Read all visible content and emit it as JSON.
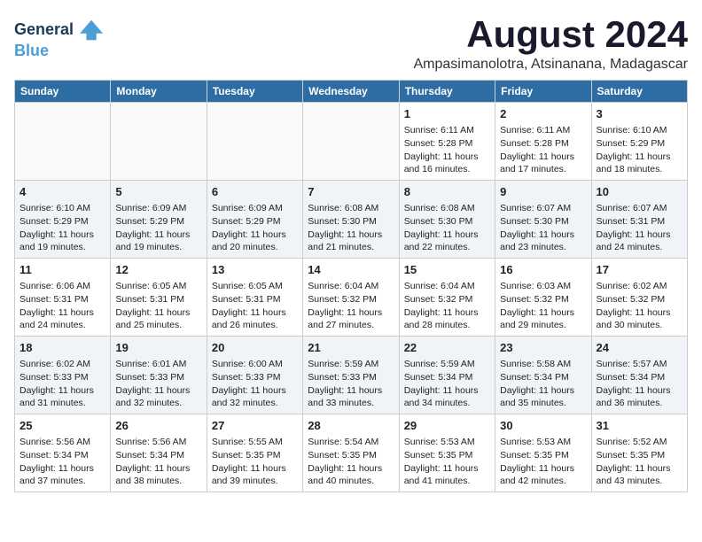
{
  "header": {
    "logo_line1": "General",
    "logo_line2": "Blue",
    "month": "August 2024",
    "location": "Ampasimanolotra, Atsinanana, Madagascar"
  },
  "weekdays": [
    "Sunday",
    "Monday",
    "Tuesday",
    "Wednesday",
    "Thursday",
    "Friday",
    "Saturday"
  ],
  "weeks": [
    [
      {
        "day": "",
        "info": ""
      },
      {
        "day": "",
        "info": ""
      },
      {
        "day": "",
        "info": ""
      },
      {
        "day": "",
        "info": ""
      },
      {
        "day": "1",
        "info": "Sunrise: 6:11 AM\nSunset: 5:28 PM\nDaylight: 11 hours and 16 minutes."
      },
      {
        "day": "2",
        "info": "Sunrise: 6:11 AM\nSunset: 5:28 PM\nDaylight: 11 hours and 17 minutes."
      },
      {
        "day": "3",
        "info": "Sunrise: 6:10 AM\nSunset: 5:29 PM\nDaylight: 11 hours and 18 minutes."
      }
    ],
    [
      {
        "day": "4",
        "info": "Sunrise: 6:10 AM\nSunset: 5:29 PM\nDaylight: 11 hours and 19 minutes."
      },
      {
        "day": "5",
        "info": "Sunrise: 6:09 AM\nSunset: 5:29 PM\nDaylight: 11 hours and 19 minutes."
      },
      {
        "day": "6",
        "info": "Sunrise: 6:09 AM\nSunset: 5:29 PM\nDaylight: 11 hours and 20 minutes."
      },
      {
        "day": "7",
        "info": "Sunrise: 6:08 AM\nSunset: 5:30 PM\nDaylight: 11 hours and 21 minutes."
      },
      {
        "day": "8",
        "info": "Sunrise: 6:08 AM\nSunset: 5:30 PM\nDaylight: 11 hours and 22 minutes."
      },
      {
        "day": "9",
        "info": "Sunrise: 6:07 AM\nSunset: 5:30 PM\nDaylight: 11 hours and 23 minutes."
      },
      {
        "day": "10",
        "info": "Sunrise: 6:07 AM\nSunset: 5:31 PM\nDaylight: 11 hours and 24 minutes."
      }
    ],
    [
      {
        "day": "11",
        "info": "Sunrise: 6:06 AM\nSunset: 5:31 PM\nDaylight: 11 hours and 24 minutes."
      },
      {
        "day": "12",
        "info": "Sunrise: 6:05 AM\nSunset: 5:31 PM\nDaylight: 11 hours and 25 minutes."
      },
      {
        "day": "13",
        "info": "Sunrise: 6:05 AM\nSunset: 5:31 PM\nDaylight: 11 hours and 26 minutes."
      },
      {
        "day": "14",
        "info": "Sunrise: 6:04 AM\nSunset: 5:32 PM\nDaylight: 11 hours and 27 minutes."
      },
      {
        "day": "15",
        "info": "Sunrise: 6:04 AM\nSunset: 5:32 PM\nDaylight: 11 hours and 28 minutes."
      },
      {
        "day": "16",
        "info": "Sunrise: 6:03 AM\nSunset: 5:32 PM\nDaylight: 11 hours and 29 minutes."
      },
      {
        "day": "17",
        "info": "Sunrise: 6:02 AM\nSunset: 5:32 PM\nDaylight: 11 hours and 30 minutes."
      }
    ],
    [
      {
        "day": "18",
        "info": "Sunrise: 6:02 AM\nSunset: 5:33 PM\nDaylight: 11 hours and 31 minutes."
      },
      {
        "day": "19",
        "info": "Sunrise: 6:01 AM\nSunset: 5:33 PM\nDaylight: 11 hours and 32 minutes."
      },
      {
        "day": "20",
        "info": "Sunrise: 6:00 AM\nSunset: 5:33 PM\nDaylight: 11 hours and 32 minutes."
      },
      {
        "day": "21",
        "info": "Sunrise: 5:59 AM\nSunset: 5:33 PM\nDaylight: 11 hours and 33 minutes."
      },
      {
        "day": "22",
        "info": "Sunrise: 5:59 AM\nSunset: 5:34 PM\nDaylight: 11 hours and 34 minutes."
      },
      {
        "day": "23",
        "info": "Sunrise: 5:58 AM\nSunset: 5:34 PM\nDaylight: 11 hours and 35 minutes."
      },
      {
        "day": "24",
        "info": "Sunrise: 5:57 AM\nSunset: 5:34 PM\nDaylight: 11 hours and 36 minutes."
      }
    ],
    [
      {
        "day": "25",
        "info": "Sunrise: 5:56 AM\nSunset: 5:34 PM\nDaylight: 11 hours and 37 minutes."
      },
      {
        "day": "26",
        "info": "Sunrise: 5:56 AM\nSunset: 5:34 PM\nDaylight: 11 hours and 38 minutes."
      },
      {
        "day": "27",
        "info": "Sunrise: 5:55 AM\nSunset: 5:35 PM\nDaylight: 11 hours and 39 minutes."
      },
      {
        "day": "28",
        "info": "Sunrise: 5:54 AM\nSunset: 5:35 PM\nDaylight: 11 hours and 40 minutes."
      },
      {
        "day": "29",
        "info": "Sunrise: 5:53 AM\nSunset: 5:35 PM\nDaylight: 11 hours and 41 minutes."
      },
      {
        "day": "30",
        "info": "Sunrise: 5:53 AM\nSunset: 5:35 PM\nDaylight: 11 hours and 42 minutes."
      },
      {
        "day": "31",
        "info": "Sunrise: 5:52 AM\nSunset: 5:35 PM\nDaylight: 11 hours and 43 minutes."
      }
    ]
  ]
}
